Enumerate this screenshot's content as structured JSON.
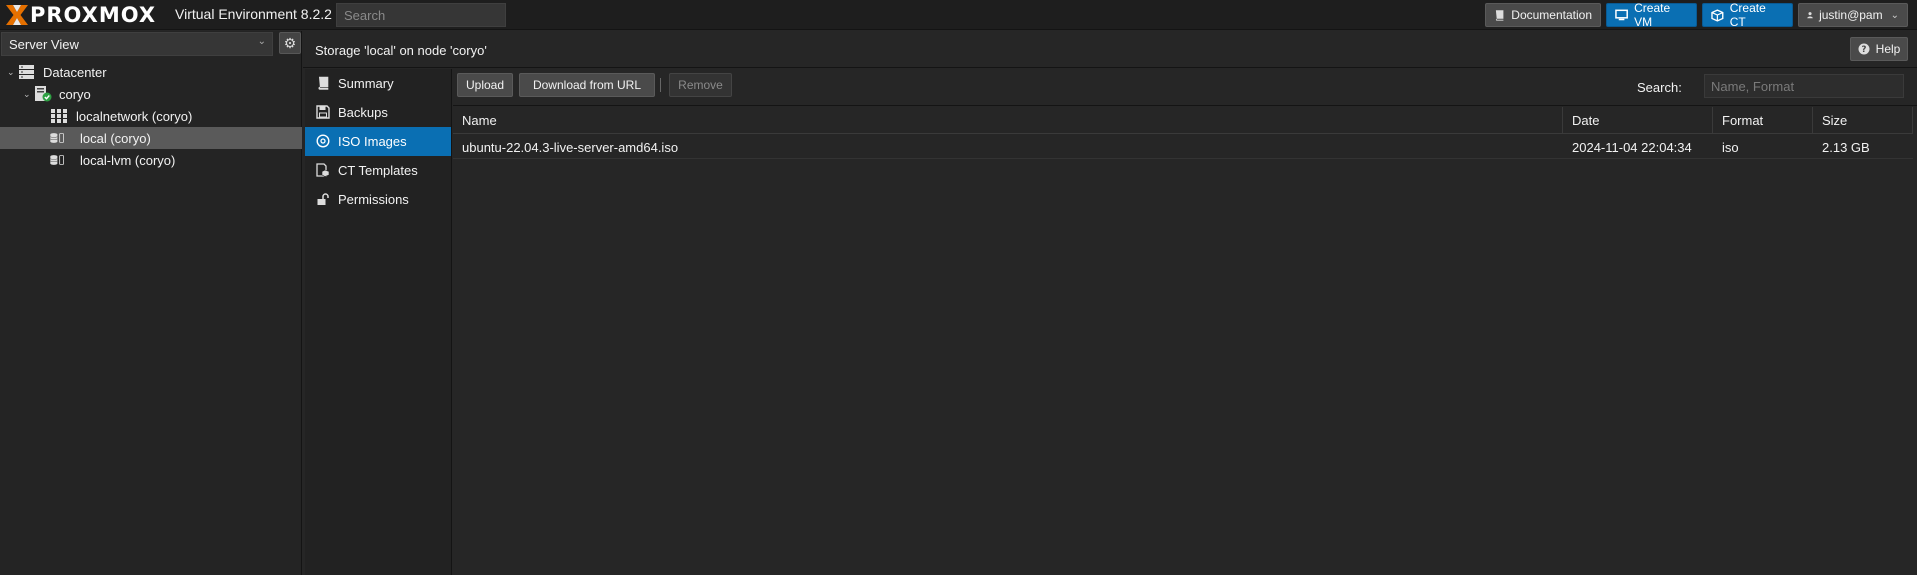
{
  "brand": {
    "logo_text": "PROXMOX",
    "version": "Virtual Environment 8.2.2"
  },
  "topbar": {
    "search_placeholder": "Search",
    "documentation_label": "Documentation",
    "create_vm_label": "Create VM",
    "create_ct_label": "Create CT",
    "user_label": "justin@pam"
  },
  "tree": {
    "view_selected": "Server View",
    "items": [
      {
        "label": "Datacenter",
        "icon": "datacenter-icon"
      },
      {
        "label": "coryo",
        "icon": "node-icon"
      },
      {
        "label": "localnetwork (coryo)",
        "icon": "sdn-grid-icon"
      },
      {
        "label": "local (coryo)",
        "icon": "storage-icon",
        "selected": true
      },
      {
        "label": "local-lvm (coryo)",
        "icon": "storage-icon"
      }
    ]
  },
  "content": {
    "title": "Storage 'local' on node 'coryo'",
    "help_label": "Help"
  },
  "subnav": {
    "items": [
      {
        "label": "Summary",
        "icon": "book-icon"
      },
      {
        "label": "Backups",
        "icon": "floppy-icon"
      },
      {
        "label": "ISO Images",
        "icon": "disc-icon",
        "active": true
      },
      {
        "label": "CT Templates",
        "icon": "template-icon"
      },
      {
        "label": "Permissions",
        "icon": "unlock-icon"
      }
    ]
  },
  "grid": {
    "upload_label": "Upload",
    "download_label": "Download from URL",
    "remove_label": "Remove",
    "search_label": "Search:",
    "search_placeholder": "Name, Format",
    "columns": [
      "Name",
      "Date",
      "Format",
      "Size"
    ],
    "rows": [
      {
        "name": "ubuntu-22.04.3-live-server-amd64.iso",
        "date": "2024-11-04 22:04:34",
        "format": "iso",
        "size": "2.13 GB"
      }
    ]
  },
  "colors": {
    "accent": "#0a6fb3",
    "brand_orange": "#e57000",
    "background": "#262626"
  }
}
